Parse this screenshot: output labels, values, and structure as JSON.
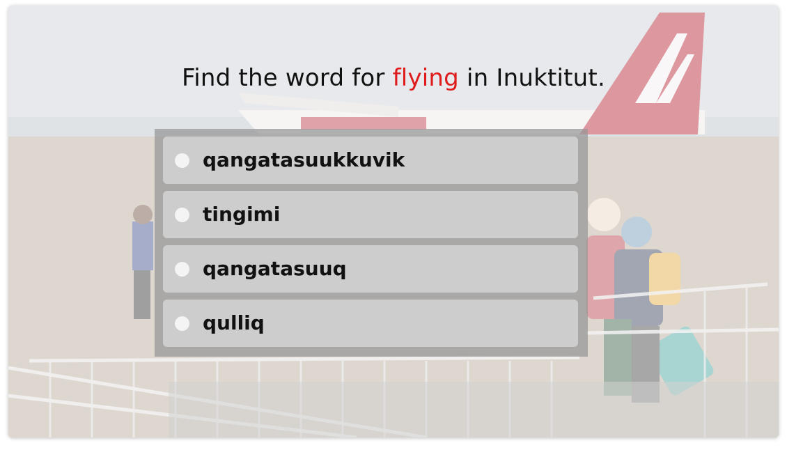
{
  "question": {
    "before": "Find the word for ",
    "highlight": "flying",
    "after": " in Inuktitut."
  },
  "options": [
    {
      "label": "qangatasuukkuvik"
    },
    {
      "label": "tingimi"
    },
    {
      "label": "qangatasuuq"
    },
    {
      "label": "qulliq"
    }
  ],
  "colors": {
    "highlight": "#e01b1b",
    "text": "#111111",
    "option_bg": "#cdcdcd",
    "panel_bg": "#969696"
  }
}
